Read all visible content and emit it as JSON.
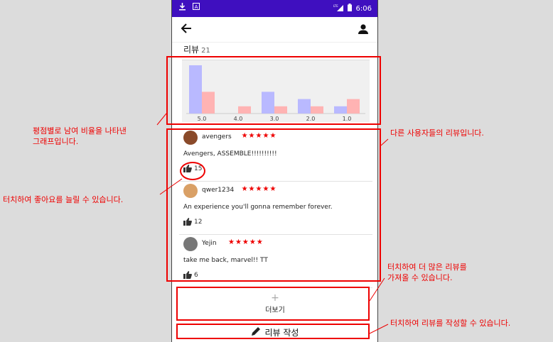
{
  "status_bar": {
    "time": "6:06",
    "network": "LTE"
  },
  "header": {
    "back_icon": "arrow-left-icon",
    "profile_icon": "person-icon"
  },
  "reviews": {
    "label": "리뷰",
    "count": "21"
  },
  "chart_data": {
    "type": "bar",
    "categories": [
      "5.0",
      "4.0",
      "3.0",
      "2.0",
      "1.0"
    ],
    "series": [
      {
        "values": [
          10,
          0,
          4.5,
          3,
          1.5
        ],
        "color": "#b9b9ff"
      },
      {
        "values": [
          4.5,
          1.5,
          1.5,
          1.5,
          3
        ],
        "color": "#ffb3b3"
      }
    ],
    "ylim": [
      0,
      10
    ]
  },
  "review_list": [
    {
      "user": "avengers",
      "stars": "★★★★★",
      "text": "Avengers, ASSEMBLE!!!!!!!!!!",
      "likes": "15",
      "avatar_color": "#8a4a2a"
    },
    {
      "user": "qwer1234",
      "stars": "★★★★★",
      "text": "An experience you'll gonna remember forever.",
      "likes": "12",
      "avatar_color": "#d9a066"
    },
    {
      "user": "Yejin",
      "stars": "★★★★★",
      "text": "take me back, marvel!! TT",
      "likes": "6",
      "avatar_color": "#777777"
    }
  ],
  "more_button": {
    "plus": "+",
    "label": "더보기"
  },
  "write_button": {
    "label": "리뷰 작성"
  },
  "annotations": {
    "chart": [
      "평점별로 남여 비율을 나타낸",
      "그래프입니다."
    ],
    "reviews": "다른 사용자들의 리뷰입니다.",
    "like": "터치하여 좋아요를 늘릴 수 있습니다.",
    "more": [
      "터치하여 더 많은 리뷰를",
      "가져올 수 있습니다."
    ],
    "write": "터치하여 리뷰를 작성할 수 있습니다."
  },
  "colors": {
    "status_bar": "#3f0fbf",
    "annotation": "#e00000",
    "star": "#ee0000"
  }
}
